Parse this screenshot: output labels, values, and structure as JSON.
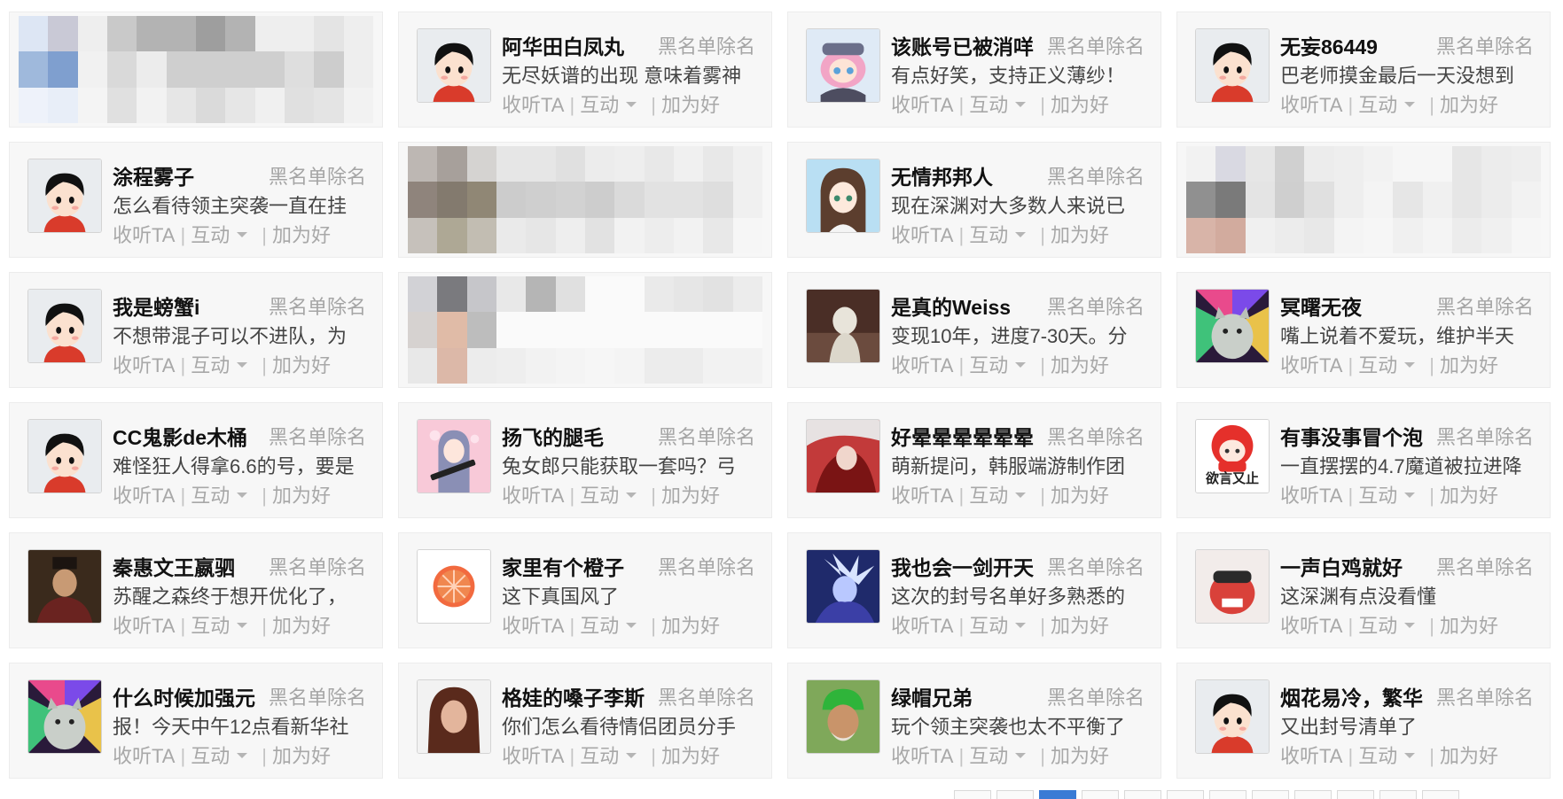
{
  "labels": {
    "blacklist": "黑名单除名",
    "follow": "收听TA",
    "interact": "互动",
    "add_friend": "加为好"
  },
  "colors": {
    "card_bg": "#f7f7f7",
    "name": "#111111",
    "muted": "#a8a8a8",
    "pager_active": "#3a7bd5"
  },
  "cards": [
    {
      "blurred": true
    },
    {
      "name": "阿华田白凤丸",
      "message": "无尽妖谱的出现 意味着雾神",
      "avatar": "default-avatar-icon"
    },
    {
      "name": "该账号已被消咩",
      "message": "有点好笑，支持正义薄纱！",
      "avatar": "anime-pink-hair-avatar-icon"
    },
    {
      "name": "无妄86449",
      "message": "巴老师摸金最后一天没想到",
      "avatar": "default-avatar-icon"
    },
    {
      "name": "涂程雾子",
      "message": "怎么看待领主突袭一直在挂",
      "avatar": "default-avatar-icon"
    },
    {
      "blurred": true
    },
    {
      "name": "无情邦邦人",
      "message": "现在深渊对大多数人来说已",
      "avatar": "anime-girl-avatar-icon"
    },
    {
      "blurred": true
    },
    {
      "name": "我是螃蟹i",
      "message": "不想带混子可以不进队，为",
      "avatar": "default-avatar-icon"
    },
    {
      "blurred": true
    },
    {
      "name": "是真的Weiss",
      "message": "变现10年，进度7-30天。分",
      "avatar": "statue-photo-avatar-icon"
    },
    {
      "name": "冥曙无夜",
      "message": "嘴上说着不爱玩，维护半天",
      "avatar": "rainbow-cat-avatar-icon"
    },
    {
      "name": "CC鬼影de木桶",
      "message": "难怪狂人得拿6.6的号，要是",
      "avatar": "default-avatar-icon"
    },
    {
      "name": "扬飞的腿毛",
      "message": "兔女郎只能获取一套吗？弓",
      "avatar": "anime-gunner-avatar-icon"
    },
    {
      "name": "好晕晕晕晕晕晕",
      "message": "萌新提问，韩服端游制作团",
      "avatar": "red-warrior-avatar-icon"
    },
    {
      "name": "有事没事冒个泡",
      "message": "一直摆摆的4.7魔道被拉进降",
      "avatar": "red-hair-chibi-avatar-icon",
      "avatar_caption": "欲言又止"
    },
    {
      "name": "秦惠文王嬴驷",
      "message": "苏醒之森终于想开优化了，",
      "avatar": "historical-figure-avatar-icon"
    },
    {
      "name": "家里有个橙子",
      "message": "这下真国风了",
      "avatar": "grapefruit-avatar-icon"
    },
    {
      "name": "我也会一剑开天",
      "message": "这次的封号名单好多熟悉的",
      "avatar": "blue-swordsman-avatar-icon"
    },
    {
      "name": "一声白鸡就好",
      "message": "这深渊有点没看懂",
      "avatar": "plush-toy-avatar-icon"
    },
    {
      "name": "什么时候加强元",
      "message": "报！今天中午12点看新华社",
      "avatar": "rainbow-cat-avatar-icon"
    },
    {
      "name": "格娃的嗓子李斯",
      "message": "你们怎么看待情侣团员分手",
      "avatar": "woman-portrait-avatar-icon"
    },
    {
      "name": "绿帽兄弟",
      "message": "玩个领主突袭也太不平衡了",
      "avatar": "green-hat-man-avatar-icon"
    },
    {
      "name": "烟花易冷，繁华",
      "message": "又出封号清单了",
      "avatar": "default-avatar-icon"
    }
  ],
  "pager": {
    "pages": 12,
    "active": 3
  }
}
